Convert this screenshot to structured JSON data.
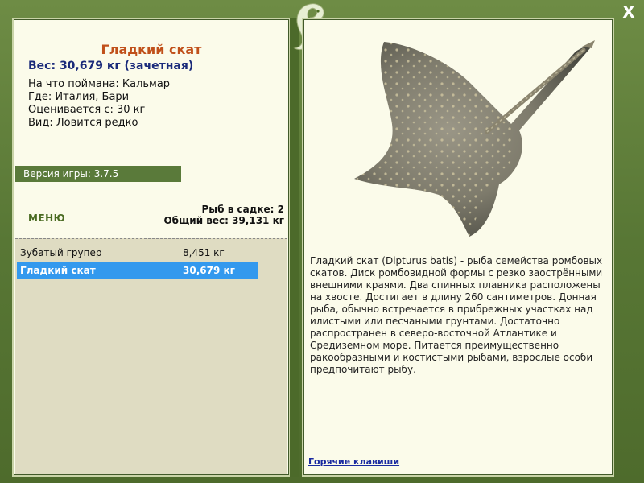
{
  "window": {
    "close_label": "X"
  },
  "fish": {
    "title": "Гладкий скат",
    "weight": "Вес: 30,679 кг (зачетная)",
    "bait": "На что поймана: Кальмар",
    "location": "Где: Италия, Бари",
    "valued_from": "Оценивается с: 30 кг",
    "kind": "Вид: Ловится редко"
  },
  "version": "Версия игры: 3.7.5",
  "menu_label": "МЕНЮ",
  "keepnet": {
    "count": "Рыб в садке: 2",
    "total_weight": "Общий вес: 39,131 кг"
  },
  "catch_list": [
    {
      "name": "Зубатый групер",
      "weight": "8,451 кг",
      "selected": false
    },
    {
      "name": "Гладкий скат",
      "weight": "30,679 кг",
      "selected": true
    }
  ],
  "description": "Гладкий скат (Dipturus batis) - рыба семейства ромбовых скатов. Диск ромбовидной формы с резко заострёнными внешними краями. Два спинных плавника расположены на хвосте. Достигает в длину 260 сантиметров. Донная рыба, обычно встречается в прибрежных участках над илистыми или песчаными грунтами. Достаточно распространен в северо-восточной Атлантике и Средиземном море. Питается преимущественно ракообразными и костистыми рыбами, взрослые особи предпочитают рыбу.",
  "hotkeys_label": "Горячие клавиши",
  "colors": {
    "frame": "#5a7a3a",
    "panel": "#fbfbea",
    "title": "#c0501a",
    "weight": "#1a2a7a",
    "selected_row": "#3399ee"
  }
}
